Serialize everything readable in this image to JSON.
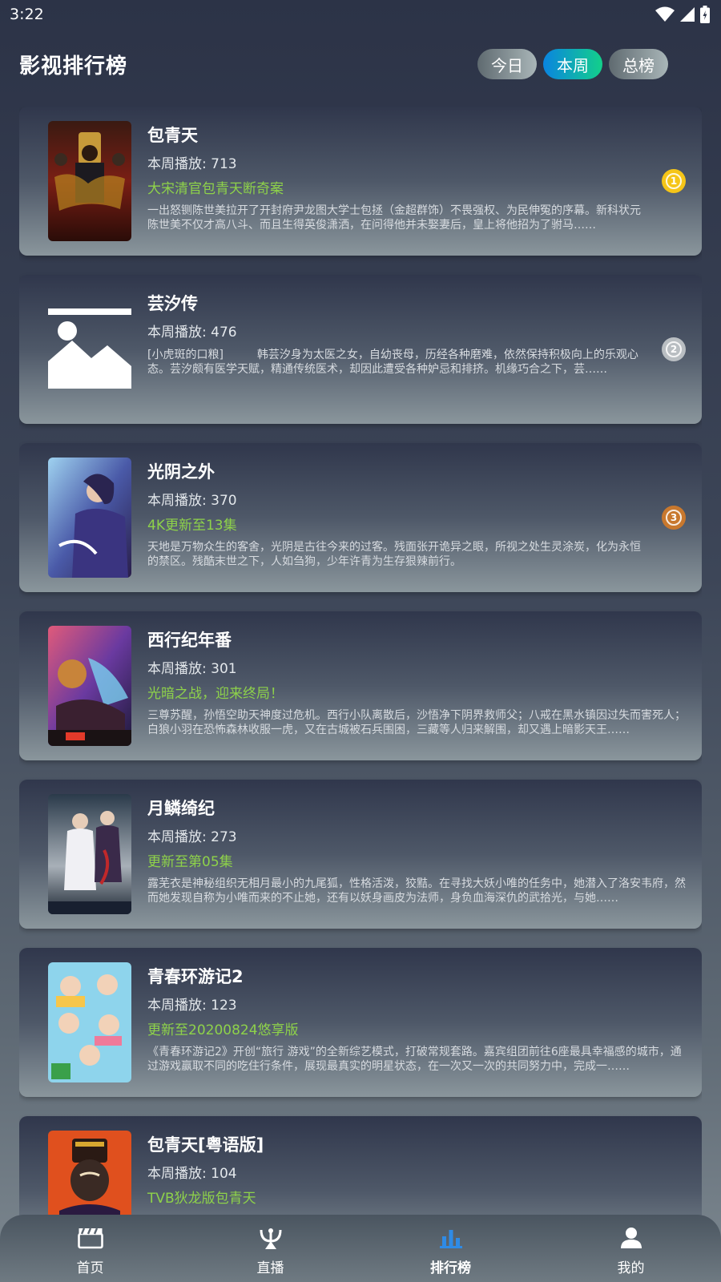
{
  "status_bar": {
    "time": "3:22"
  },
  "header": {
    "title": "影视排行榜",
    "tabs": [
      {
        "label": "今日",
        "active": false
      },
      {
        "label": "本周",
        "active": true
      },
      {
        "label": "总榜",
        "active": false
      }
    ]
  },
  "list": {
    "items": [
      {
        "title": "包青天",
        "plays": "本周播放: 713",
        "tagline": "大宋清官包青天断奇案",
        "description": "一出怒铡陈世美拉开了开封府尹龙图大学士包拯（金超群饰）不畏强权、为民伸冤的序幕。新科状元陈世美不仅才高八斗、而且生得英俊潇洒，在问得他并未娶妻后，皇上将他招为了驸马……",
        "rank": "1",
        "rank_color": "#f5c518"
      },
      {
        "title": "芸汐传",
        "plays": "本周播放: 476",
        "tagline": "",
        "description": "[小虎斑的口粮]　　　韩芸汐身为太医之女，自幼丧母，历经各种磨难，依然保持积极向上的乐观心态。芸汐颇有医学天赋，精通传统医术，却因此遭受各种妒忌和排挤。机缘巧合之下，芸……",
        "rank": "2",
        "rank_color": "#b9bec2"
      },
      {
        "title": "光阴之外",
        "plays": "本周播放: 370",
        "tagline": "4K更新至13集",
        "description": "天地是万物众生的客舍，光阴是古往今来的过客。残面张开诡异之眼，所视之处生灵涂炭，化为永恒的禁区。残酷末世之下，人如刍狗，少年许青为生存狠辣前行。",
        "rank": "3",
        "rank_color": "#c8782e"
      },
      {
        "title": "西行纪年番",
        "plays": "本周播放: 301",
        "tagline": "光暗之战，迎来终局！",
        "description": "三尊苏醒，孙悟空助天神度过危机。西行小队离散后，沙悟净下阴界救师父；八戒在黑水镇因过失而害死人；白狼小羽在恐怖森林收服一虎，又在古城被石兵围困，三藏等人归来解围，却又遇上暗影天王……",
        "rank": "",
        "rank_color": ""
      },
      {
        "title": "月鳞绮纪",
        "plays": "本周播放: 273",
        "tagline": "更新至第05集",
        "description": "露芜衣是神秘组织无相月最小的九尾狐，性格活泼，狡黠。在寻找大妖小唯的任务中，她潜入了洛安韦府，然而她发现自称为小唯而来的不止她，还有以妖身画皮为法师，身负血海深仇的武拾光，与她……",
        "rank": "",
        "rank_color": ""
      },
      {
        "title": "青春环游记2",
        "plays": "本周播放: 123",
        "tagline": "更新至20200824悠享版",
        "description": "《青春环游记2》开创“旅行 游戏”的全新综艺模式，打破常规套路。嘉宾组团前往6座最具幸福感的城市，通过游戏赢取不同的吃住行条件，展现最真实的明星状态，在一次又一次的共同努力中，完成一……",
        "rank": "",
        "rank_color": ""
      },
      {
        "title": "包青天[粤语版]",
        "plays": "本周播放: 104",
        "tagline": "TVB狄龙版包青天",
        "description": "",
        "rank": "",
        "rank_color": ""
      }
    ]
  },
  "bottom_nav": {
    "items": [
      {
        "label": "首页",
        "icon": "clapperboard-icon",
        "active": false
      },
      {
        "label": "直播",
        "icon": "satellite-dish-icon",
        "active": false
      },
      {
        "label": "排行榜",
        "icon": "bar-chart-icon",
        "active": true
      },
      {
        "label": "我的",
        "icon": "person-icon",
        "active": false
      }
    ]
  },
  "colors": {
    "accent": "#2f8be6",
    "tagline": "#8ed24a",
    "tab_active_start": "#0a84e0",
    "tab_active_end": "#13d08a"
  }
}
